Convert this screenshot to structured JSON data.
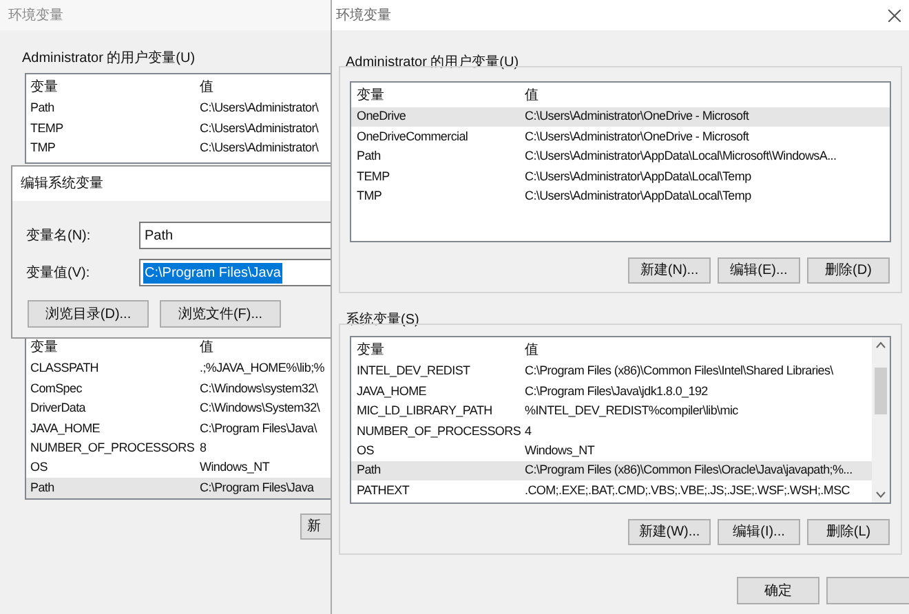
{
  "back_window": {
    "title": "环境变量",
    "user_group": {
      "label": "Administrator 的用户变量(U)",
      "columns": [
        "变量",
        "值"
      ],
      "rows": [
        {
          "name": "Path",
          "value": "C:\\Users\\Administrator\\",
          "selected": false
        },
        {
          "name": "TEMP",
          "value": "C:\\Users\\Administrator\\",
          "selected": false
        },
        {
          "name": "TMP",
          "value": "C:\\Users\\Administrator\\",
          "selected": false
        }
      ]
    },
    "system_list": {
      "columns": [
        "变量",
        "值"
      ],
      "rows": [
        {
          "name": "CLASSPATH",
          "value": ".;%JAVA_HOME%\\lib;%",
          "selected": false
        },
        {
          "name": "ComSpec",
          "value": "C:\\Windows\\system32\\",
          "selected": false
        },
        {
          "name": "DriverData",
          "value": "C:\\Windows\\System32\\",
          "selected": false
        },
        {
          "name": "JAVA_HOME",
          "value": "C:\\Program Files\\Java\\",
          "selected": false
        },
        {
          "name": "NUMBER_OF_PROCESSORS",
          "value": "8",
          "selected": false
        },
        {
          "name": "OS",
          "value": "Windows_NT",
          "selected": false
        },
        {
          "name": "Path",
          "value": "C:\\Program Files\\Java",
          "selected": true
        }
      ]
    },
    "buttons": [
      "新"
    ]
  },
  "edit_dialog": {
    "title": "编辑系统变量",
    "fields": [
      {
        "label": "变量名(N):",
        "value": "Path",
        "text_selected": false
      },
      {
        "label": "变量值(V):",
        "value": "C:\\Program Files\\Java",
        "text_selected": true
      }
    ],
    "buttons": [
      "浏览目录(D)...",
      "浏览文件(F)..."
    ]
  },
  "front_window": {
    "title": "环境变量",
    "user_group": {
      "label": "Administrator 的用户变量(U)",
      "columns": [
        "变量",
        "值"
      ],
      "rows": [
        {
          "name": "OneDrive",
          "value": "C:\\Users\\Administrator\\OneDrive - Microsoft",
          "selected": true
        },
        {
          "name": "OneDriveCommercial",
          "value": "C:\\Users\\Administrator\\OneDrive - Microsoft",
          "selected": false
        },
        {
          "name": "Path",
          "value": "C:\\Users\\Administrator\\AppData\\Local\\Microsoft\\WindowsA...",
          "selected": false
        },
        {
          "name": "TEMP",
          "value": "C:\\Users\\Administrator\\AppData\\Local\\Temp",
          "selected": false
        },
        {
          "name": "TMP",
          "value": "C:\\Users\\Administrator\\AppData\\Local\\Temp",
          "selected": false
        }
      ],
      "buttons": [
        "新建(N)...",
        "编辑(E)...",
        "删除(D)"
      ]
    },
    "system_group": {
      "label": "系统变量(S)",
      "columns": [
        "变量",
        "值"
      ],
      "rows": [
        {
          "name": "INTEL_DEV_REDIST",
          "value": "C:\\Program Files (x86)\\Common Files\\Intel\\Shared Libraries\\",
          "selected": false
        },
        {
          "name": "JAVA_HOME",
          "value": "C:\\Program Files\\Java\\jdk1.8.0_192",
          "selected": false
        },
        {
          "name": "MIC_LD_LIBRARY_PATH",
          "value": "%INTEL_DEV_REDIST%compiler\\lib\\mic",
          "selected": false
        },
        {
          "name": "NUMBER_OF_PROCESSORS",
          "value": "4",
          "selected": false
        },
        {
          "name": "OS",
          "value": "Windows_NT",
          "selected": false
        },
        {
          "name": "Path",
          "value": "C:\\Program Files (x86)\\Common Files\\Oracle\\Java\\javapath;%...",
          "selected": true
        },
        {
          "name": "PATHEXT",
          "value": ".COM;.EXE;.BAT;.CMD;.VBS;.VBE;.JS;.JSE;.WSF;.WSH;.MSC",
          "selected": false
        }
      ],
      "buttons": [
        "新建(W)...",
        "编辑(I)...",
        "删除(L)"
      ]
    },
    "footer_buttons": [
      "确定"
    ]
  }
}
